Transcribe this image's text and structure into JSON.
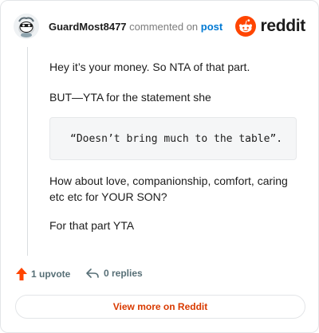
{
  "comment": {
    "username": "GuardMost8477",
    "commented_text": "commented on",
    "post_link": "post",
    "paragraphs": [
      "Hey it’s your money. So NTA of that part.",
      "BUT—YTA for the statement she",
      "How about love, companionship, comfort, caring etc etc for YOUR SON?",
      "For that part YTA"
    ],
    "quote": "“Doesn’t bring much to the table”."
  },
  "brand": {
    "wordmark": "reddit",
    "color": "#ff4500"
  },
  "footer": {
    "upvote_label": "1 upvote",
    "replies_label": "0 replies",
    "upvote_icon": "upvote-arrow-icon",
    "reply_icon": "reply-arrow-icon"
  },
  "cta": {
    "label": "View more on Reddit",
    "color": "#d93a00"
  }
}
